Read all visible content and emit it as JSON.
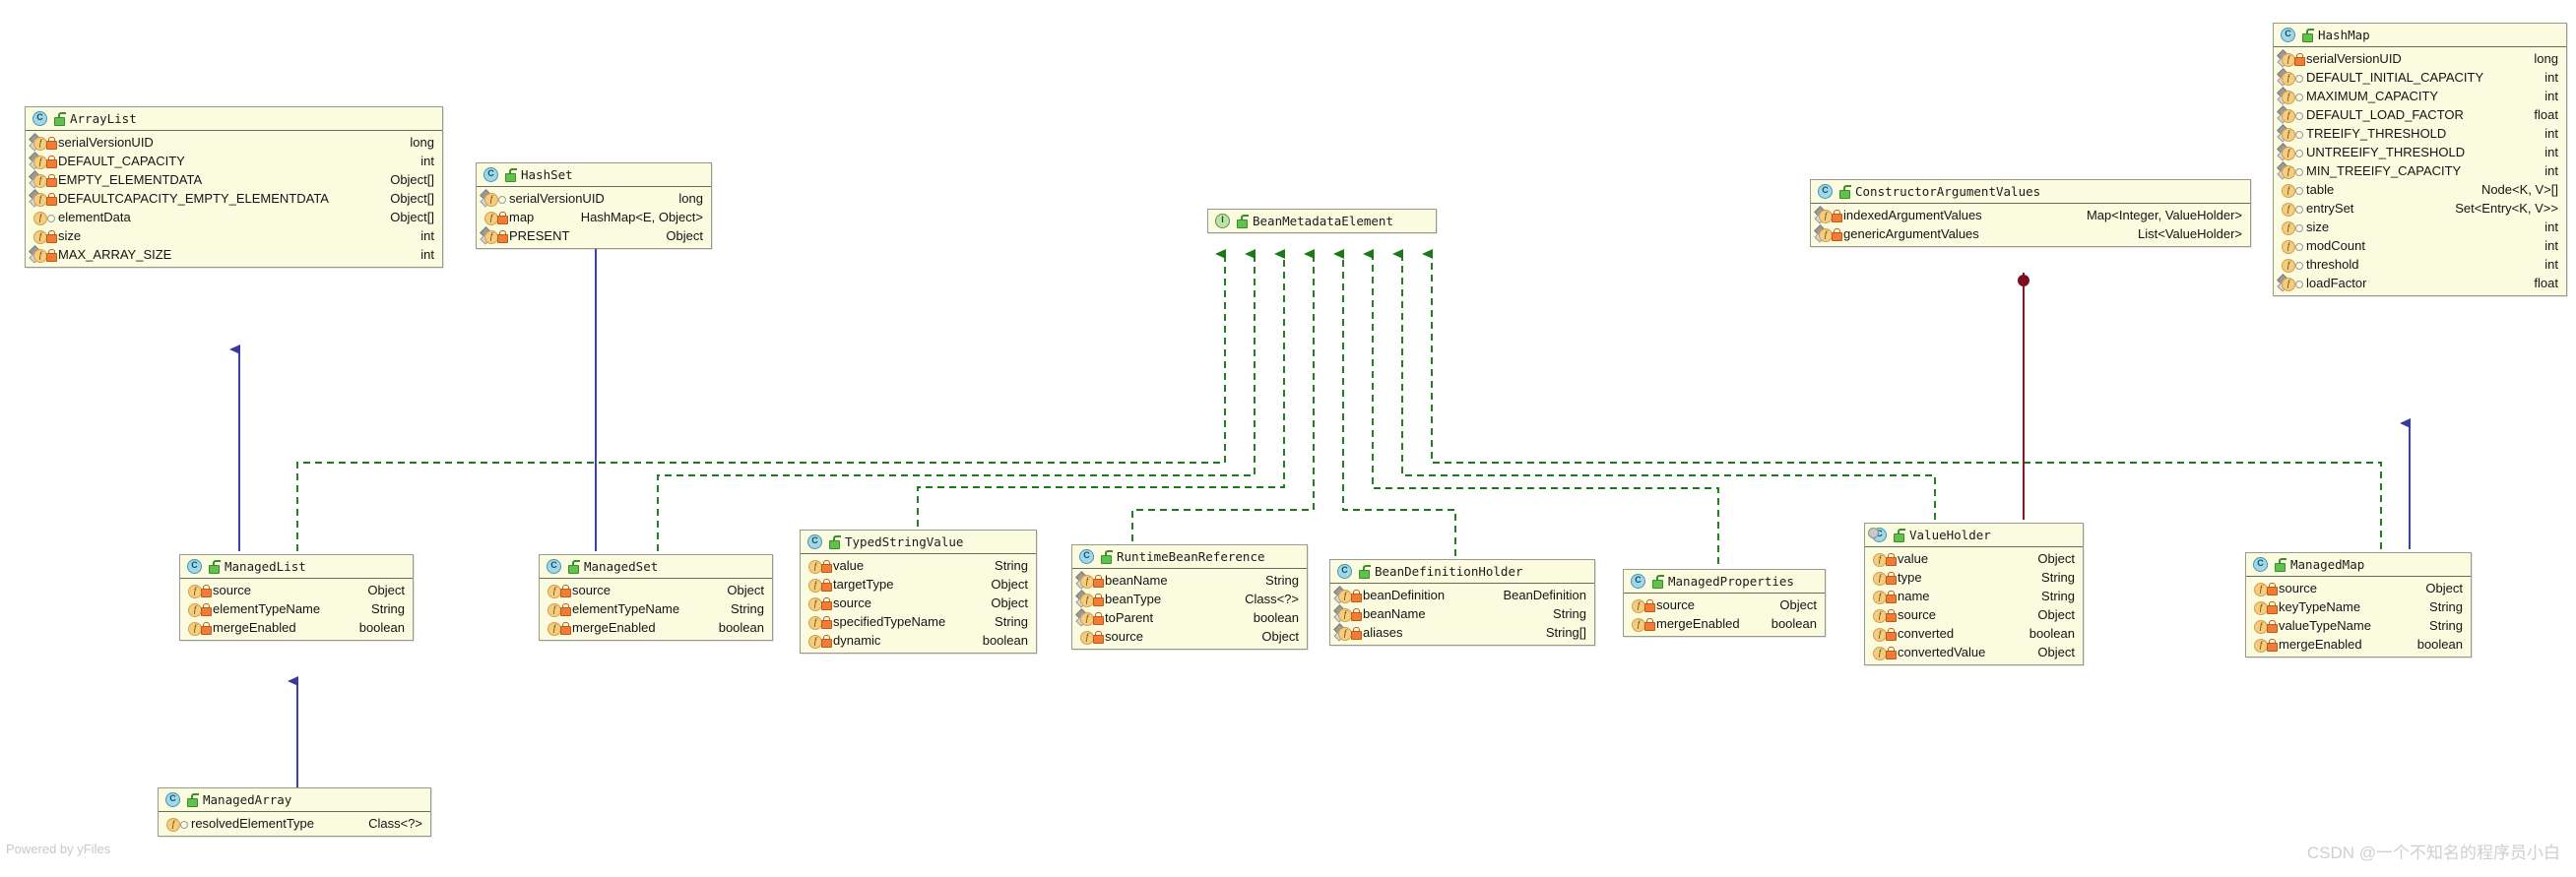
{
  "diagram": {
    "title": "Spring BeanMetadataElement class hierarchy",
    "colors": {
      "box_fill": "#fbfbe0",
      "box_border": "#9a9a8c",
      "realization_edge": "#1a7a1a",
      "inheritance_edge": "#39399c",
      "association_edge": "#7a1020"
    }
  },
  "watermarks": {
    "left": "Powered by yFiles",
    "right": "CSDN @一个不知名的程序员小白"
  },
  "icons": {
    "class": "C",
    "interface": "I",
    "field": "f",
    "unlock": "unlock-icon",
    "private": "private-lock-icon",
    "package": "package-visibility-icon"
  },
  "classes": [
    {
      "id": "arraylist",
      "name": "ArrayList",
      "kind": "class",
      "members": [
        {
          "name": "serialVersionUID",
          "type": "long",
          "vis": "private",
          "static": true
        },
        {
          "name": "DEFAULT_CAPACITY",
          "type": "int",
          "vis": "private",
          "static": true
        },
        {
          "name": "EMPTY_ELEMENTDATA",
          "type": "Object[]",
          "vis": "private",
          "static": true
        },
        {
          "name": "DEFAULTCAPACITY_EMPTY_ELEMENTDATA",
          "type": "Object[]",
          "vis": "private",
          "static": true
        },
        {
          "name": "elementData",
          "type": "Object[]",
          "vis": "package",
          "static": false
        },
        {
          "name": "size",
          "type": "int",
          "vis": "private",
          "static": false
        },
        {
          "name": "MAX_ARRAY_SIZE",
          "type": "int",
          "vis": "private",
          "static": true
        }
      ]
    },
    {
      "id": "hashset",
      "name": "HashSet",
      "kind": "class",
      "members": [
        {
          "name": "serialVersionUID",
          "type": "long",
          "vis": "package",
          "static": true
        },
        {
          "name": "map",
          "type": "HashMap<E, Object>",
          "vis": "private",
          "static": false
        },
        {
          "name": "PRESENT",
          "type": "Object",
          "vis": "private",
          "static": true
        }
      ]
    },
    {
      "id": "beanmetadataelement",
      "name": "BeanMetadataElement",
      "kind": "interface",
      "members": []
    },
    {
      "id": "constructorargumentvalues",
      "name": "ConstructorArgumentValues",
      "kind": "class",
      "members": [
        {
          "name": "indexedArgumentValues",
          "type": "Map<Integer, ValueHolder>",
          "vis": "private",
          "static": true
        },
        {
          "name": "genericArgumentValues",
          "type": "List<ValueHolder>",
          "vis": "private",
          "static": true
        }
      ]
    },
    {
      "id": "hashmap",
      "name": "HashMap",
      "kind": "class",
      "members": [
        {
          "name": "serialVersionUID",
          "type": "long",
          "vis": "private",
          "static": true
        },
        {
          "name": "DEFAULT_INITIAL_CAPACITY",
          "type": "int",
          "vis": "package",
          "static": true
        },
        {
          "name": "MAXIMUM_CAPACITY",
          "type": "int",
          "vis": "package",
          "static": true
        },
        {
          "name": "DEFAULT_LOAD_FACTOR",
          "type": "float",
          "vis": "package",
          "static": true
        },
        {
          "name": "TREEIFY_THRESHOLD",
          "type": "int",
          "vis": "package",
          "static": true
        },
        {
          "name": "UNTREEIFY_THRESHOLD",
          "type": "int",
          "vis": "package",
          "static": true
        },
        {
          "name": "MIN_TREEIFY_CAPACITY",
          "type": "int",
          "vis": "package",
          "static": true
        },
        {
          "name": "table",
          "type": "Node<K, V>[]",
          "vis": "package",
          "static": false
        },
        {
          "name": "entrySet",
          "type": "Set<Entry<K, V>>",
          "vis": "package",
          "static": false
        },
        {
          "name": "size",
          "type": "int",
          "vis": "package",
          "static": false
        },
        {
          "name": "modCount",
          "type": "int",
          "vis": "package",
          "static": false
        },
        {
          "name": "threshold",
          "type": "int",
          "vis": "package",
          "static": false
        },
        {
          "name": "loadFactor",
          "type": "float",
          "vis": "package",
          "static": true
        }
      ]
    },
    {
      "id": "managedlist",
      "name": "ManagedList",
      "kind": "class",
      "members": [
        {
          "name": "source",
          "type": "Object",
          "vis": "private",
          "static": false
        },
        {
          "name": "elementTypeName",
          "type": "String",
          "vis": "private",
          "static": false
        },
        {
          "name": "mergeEnabled",
          "type": "boolean",
          "vis": "private",
          "static": false
        }
      ]
    },
    {
      "id": "managedset",
      "name": "ManagedSet",
      "kind": "class",
      "members": [
        {
          "name": "source",
          "type": "Object",
          "vis": "private",
          "static": false
        },
        {
          "name": "elementTypeName",
          "type": "String",
          "vis": "private",
          "static": false
        },
        {
          "name": "mergeEnabled",
          "type": "boolean",
          "vis": "private",
          "static": false
        }
      ]
    },
    {
      "id": "typedstringvalue",
      "name": "TypedStringValue",
      "kind": "class",
      "members": [
        {
          "name": "value",
          "type": "String",
          "vis": "private",
          "static": false
        },
        {
          "name": "targetType",
          "type": "Object",
          "vis": "private",
          "static": false
        },
        {
          "name": "source",
          "type": "Object",
          "vis": "private",
          "static": false
        },
        {
          "name": "specifiedTypeName",
          "type": "String",
          "vis": "private",
          "static": false
        },
        {
          "name": "dynamic",
          "type": "boolean",
          "vis": "private",
          "static": false
        }
      ]
    },
    {
      "id": "runtimebeanreference",
      "name": "RuntimeBeanReference",
      "kind": "class",
      "members": [
        {
          "name": "beanName",
          "type": "String",
          "vis": "private",
          "static": true
        },
        {
          "name": "beanType",
          "type": "Class<?>",
          "vis": "private",
          "static": true
        },
        {
          "name": "toParent",
          "type": "boolean",
          "vis": "private",
          "static": true
        },
        {
          "name": "source",
          "type": "Object",
          "vis": "private",
          "static": false
        }
      ]
    },
    {
      "id": "beandefinitionholder",
      "name": "BeanDefinitionHolder",
      "kind": "class",
      "members": [
        {
          "name": "beanDefinition",
          "type": "BeanDefinition",
          "vis": "private",
          "static": true
        },
        {
          "name": "beanName",
          "type": "String",
          "vis": "private",
          "static": true
        },
        {
          "name": "aliases",
          "type": "String[]",
          "vis": "private",
          "static": true
        }
      ]
    },
    {
      "id": "managedproperties",
      "name": "ManagedProperties",
      "kind": "class",
      "members": [
        {
          "name": "source",
          "type": "Object",
          "vis": "private",
          "static": false
        },
        {
          "name": "mergeEnabled",
          "type": "boolean",
          "vis": "private",
          "static": false
        }
      ]
    },
    {
      "id": "valueholder",
      "name": "ValueHolder",
      "kind": "nested-class",
      "members": [
        {
          "name": "value",
          "type": "Object",
          "vis": "private",
          "static": false
        },
        {
          "name": "type",
          "type": "String",
          "vis": "private",
          "static": false
        },
        {
          "name": "name",
          "type": "String",
          "vis": "private",
          "static": false
        },
        {
          "name": "source",
          "type": "Object",
          "vis": "private",
          "static": false
        },
        {
          "name": "converted",
          "type": "boolean",
          "vis": "private",
          "static": false
        },
        {
          "name": "convertedValue",
          "type": "Object",
          "vis": "private",
          "static": false
        }
      ]
    },
    {
      "id": "managedmap",
      "name": "ManagedMap",
      "kind": "class",
      "members": [
        {
          "name": "source",
          "type": "Object",
          "vis": "private",
          "static": false
        },
        {
          "name": "keyTypeName",
          "type": "String",
          "vis": "private",
          "static": false
        },
        {
          "name": "valueTypeName",
          "type": "String",
          "vis": "private",
          "static": false
        },
        {
          "name": "mergeEnabled",
          "type": "boolean",
          "vis": "private",
          "static": false
        }
      ]
    },
    {
      "id": "managedarray",
      "name": "ManagedArray",
      "kind": "class",
      "members": [
        {
          "name": "resolvedElementType",
          "type": "Class<?>",
          "vis": "package",
          "static": false
        }
      ]
    }
  ],
  "relations": [
    {
      "from": "managedlist",
      "to": "beanmetadataelement",
      "type": "realization"
    },
    {
      "from": "managedset",
      "to": "beanmetadataelement",
      "type": "realization"
    },
    {
      "from": "typedstringvalue",
      "to": "beanmetadataelement",
      "type": "realization"
    },
    {
      "from": "runtimebeanreference",
      "to": "beanmetadataelement",
      "type": "realization"
    },
    {
      "from": "beandefinitionholder",
      "to": "beanmetadataelement",
      "type": "realization"
    },
    {
      "from": "managedproperties",
      "to": "beanmetadataelement",
      "type": "realization"
    },
    {
      "from": "valueholder",
      "to": "beanmetadataelement",
      "type": "realization"
    },
    {
      "from": "managedmap",
      "to": "beanmetadataelement",
      "type": "realization"
    },
    {
      "from": "managedlist",
      "to": "arraylist",
      "type": "inheritance"
    },
    {
      "from": "managedset",
      "to": "hashset",
      "type": "inheritance"
    },
    {
      "from": "managedmap",
      "to": "hashmap",
      "type": "inheritance"
    },
    {
      "from": "managedarray",
      "to": "managedlist",
      "type": "inheritance"
    },
    {
      "from": "constructorargumentvalues",
      "to": "valueholder",
      "type": "association"
    }
  ]
}
